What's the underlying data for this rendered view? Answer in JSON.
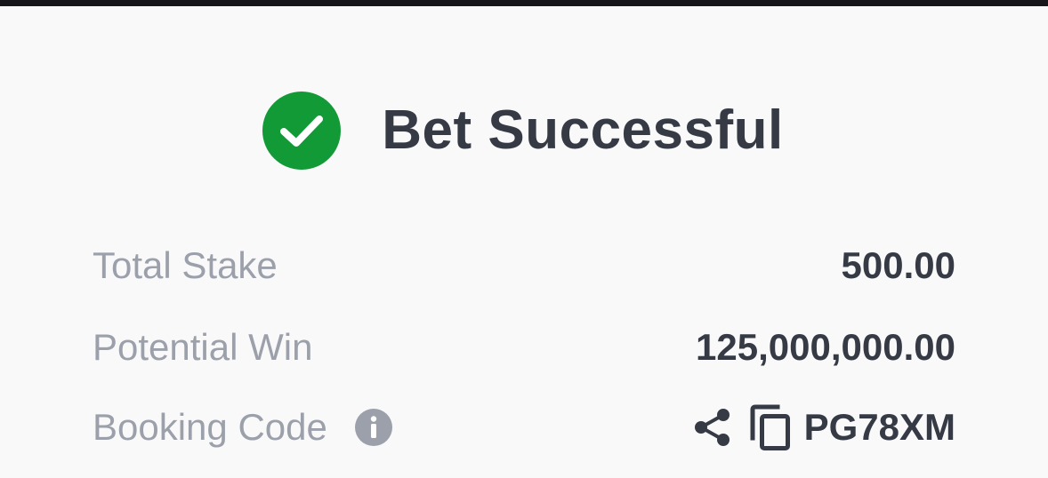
{
  "header": {
    "title": "Bet Successful",
    "icon": "check-circle-icon"
  },
  "details": {
    "total_stake_label": "Total Stake",
    "total_stake_value": "500.00",
    "potential_win_label": "Potential Win",
    "potential_win_value": "125,000,000.00",
    "booking_code_label": "Booking Code",
    "booking_code_value": "PG78XM"
  },
  "icons": {
    "info": "info-icon",
    "share": "share-icon",
    "copy": "copy-icon"
  },
  "colors": {
    "success": "#129a37",
    "text_dark": "#353a45",
    "text_muted": "#9ba0ab",
    "background": "#f9f9fa",
    "top_bar": "#17171b"
  }
}
